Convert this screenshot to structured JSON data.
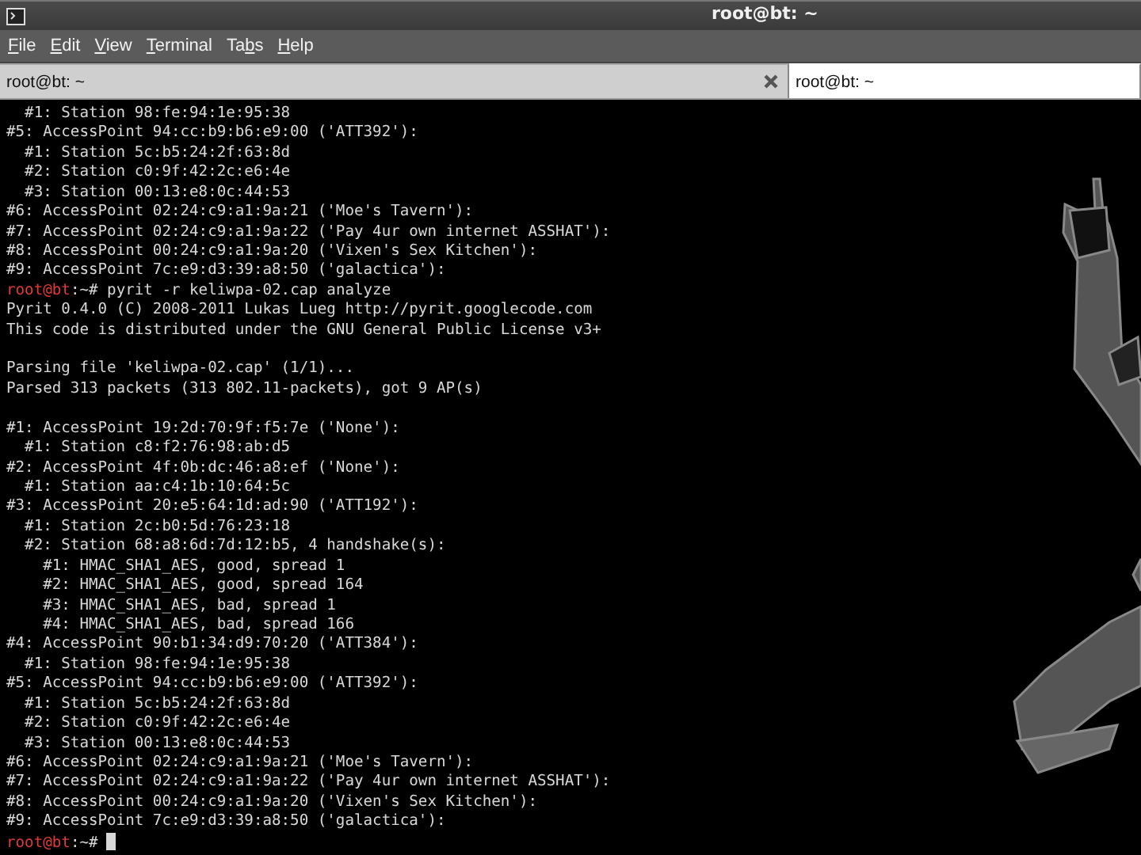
{
  "window": {
    "title": "root@bt: ~"
  },
  "menu": [
    {
      "mnemonic": "F",
      "rest": "ile"
    },
    {
      "mnemonic": "E",
      "rest": "dit"
    },
    {
      "mnemonic": "V",
      "rest": "iew"
    },
    {
      "mnemonic": "T",
      "rest": "erminal"
    },
    {
      "start": "Ta",
      "mnemonic": "b",
      "rest": "s"
    },
    {
      "mnemonic": "H",
      "rest": "elp"
    }
  ],
  "tabs": [
    {
      "label": "root@bt: ~",
      "selected": false,
      "closable": true
    },
    {
      "label": "root@bt: ~",
      "selected": true,
      "closable": false
    }
  ],
  "terminal": {
    "lines": [
      {
        "kind": "output",
        "text": "  #1: Station 98:fe:94:1e:95:38"
      },
      {
        "kind": "output",
        "text": "#5: AccessPoint 94:cc:b9:b6:e9:00 ('ATT392'):"
      },
      {
        "kind": "output",
        "text": "  #1: Station 5c:b5:24:2f:63:8d"
      },
      {
        "kind": "output",
        "text": "  #2: Station c0:9f:42:2c:e6:4e"
      },
      {
        "kind": "output",
        "text": "  #3: Station 00:13:e8:0c:44:53"
      },
      {
        "kind": "output",
        "text": "#6: AccessPoint 02:24:c9:a1:9a:21 ('Moe's Tavern'):"
      },
      {
        "kind": "output",
        "text": "#7: AccessPoint 02:24:c9:a1:9a:22 ('Pay 4ur own internet ASSHAT'):"
      },
      {
        "kind": "output",
        "text": "#8: AccessPoint 00:24:c9:a1:9a:20 ('Vixen's Sex Kitchen'):"
      },
      {
        "kind": "output",
        "text": "#9: AccessPoint 7c:e9:d3:39:a8:50 ('galactica'):"
      },
      {
        "kind": "prompt",
        "user": "root@bt",
        "path": ":~#",
        "command": "pyrit -r keliwpa-02.cap analyze",
        "cursor": false
      },
      {
        "kind": "output",
        "text": "Pyrit 0.4.0 (C) 2008-2011 Lukas Lueg http://pyrit.googlecode.com"
      },
      {
        "kind": "output",
        "text": "This code is distributed under the GNU General Public License v3+"
      },
      {
        "kind": "blank"
      },
      {
        "kind": "output",
        "text": "Parsing file 'keliwpa-02.cap' (1/1)..."
      },
      {
        "kind": "output",
        "text": "Parsed 313 packets (313 802.11-packets), got 9 AP(s)"
      },
      {
        "kind": "blank"
      },
      {
        "kind": "output",
        "text": "#1: AccessPoint 19:2d:70:9f:f5:7e ('None'):"
      },
      {
        "kind": "output",
        "text": "  #1: Station c8:f2:76:98:ab:d5"
      },
      {
        "kind": "output",
        "text": "#2: AccessPoint 4f:0b:dc:46:a8:ef ('None'):"
      },
      {
        "kind": "output",
        "text": "  #1: Station aa:c4:1b:10:64:5c"
      },
      {
        "kind": "output",
        "text": "#3: AccessPoint 20:e5:64:1d:ad:90 ('ATT192'):"
      },
      {
        "kind": "output",
        "text": "  #1: Station 2c:b0:5d:76:23:18"
      },
      {
        "kind": "output",
        "text": "  #2: Station 68:a8:6d:7d:12:b5, 4 handshake(s):"
      },
      {
        "kind": "output",
        "text": "    #1: HMAC_SHA1_AES, good, spread 1"
      },
      {
        "kind": "output",
        "text": "    #2: HMAC_SHA1_AES, good, spread 164"
      },
      {
        "kind": "output",
        "text": "    #3: HMAC_SHA1_AES, bad, spread 1"
      },
      {
        "kind": "output",
        "text": "    #4: HMAC_SHA1_AES, bad, spread 166"
      },
      {
        "kind": "output",
        "text": "#4: AccessPoint 90:b1:34:d9:70:20 ('ATT384'):"
      },
      {
        "kind": "output",
        "text": "  #1: Station 98:fe:94:1e:95:38"
      },
      {
        "kind": "output",
        "text": "#5: AccessPoint 94:cc:b9:b6:e9:00 ('ATT392'):"
      },
      {
        "kind": "output",
        "text": "  #1: Station 5c:b5:24:2f:63:8d"
      },
      {
        "kind": "output",
        "text": "  #2: Station c0:9f:42:2c:e6:4e"
      },
      {
        "kind": "output",
        "text": "  #3: Station 00:13:e8:0c:44:53"
      },
      {
        "kind": "output",
        "text": "#6: AccessPoint 02:24:c9:a1:9a:21 ('Moe's Tavern'):"
      },
      {
        "kind": "output",
        "text": "#7: AccessPoint 02:24:c9:a1:9a:22 ('Pay 4ur own internet ASSHAT'):"
      },
      {
        "kind": "output",
        "text": "#8: AccessPoint 00:24:c9:a1:9a:20 ('Vixen's Sex Kitchen'):"
      },
      {
        "kind": "output",
        "text": "#9: AccessPoint 7c:e9:d3:39:a8:50 ('galactica'):"
      },
      {
        "kind": "prompt",
        "user": "root@bt",
        "path": ":~#",
        "cursor": true
      }
    ]
  }
}
